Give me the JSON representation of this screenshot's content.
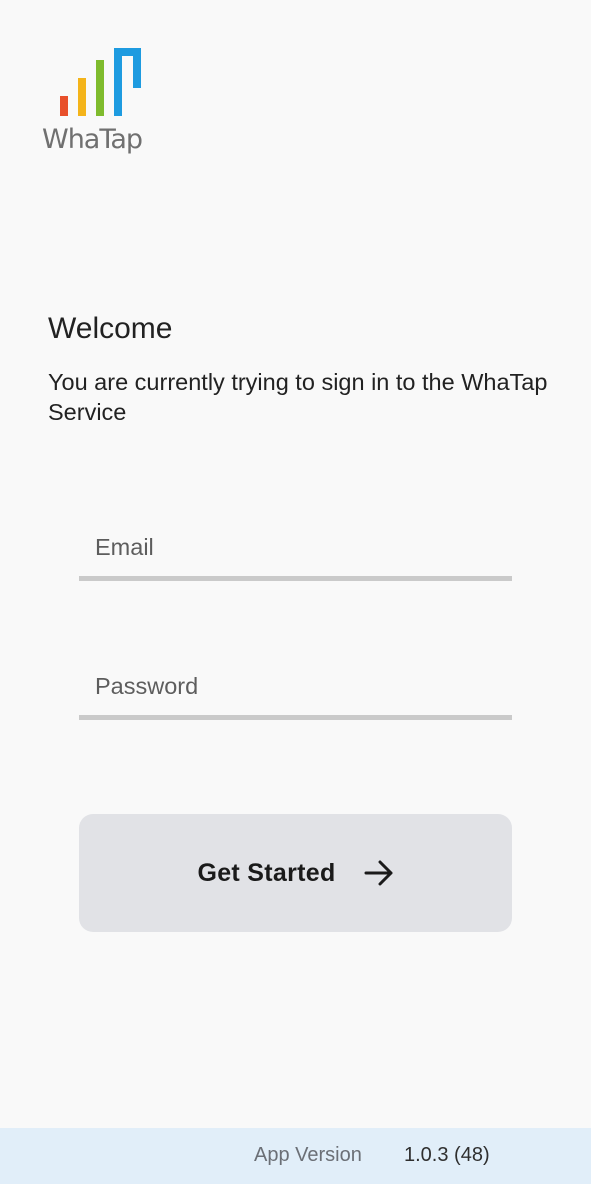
{
  "brand": {
    "name": "WhaTap",
    "logo_colors": [
      "#e8502b",
      "#f4b41a",
      "#7fbb2d",
      "#1e9be0"
    ]
  },
  "welcome": {
    "title": "Welcome",
    "subtitle": "You are currently trying to sign in to the WhaTap Service"
  },
  "form": {
    "email_placeholder": "Email",
    "password_placeholder": "Password",
    "submit_label": "Get Started",
    "submit_icon": "arrow-right-icon"
  },
  "footer": {
    "version_label": "App Version",
    "version_value": "1.0.3 (48)"
  }
}
